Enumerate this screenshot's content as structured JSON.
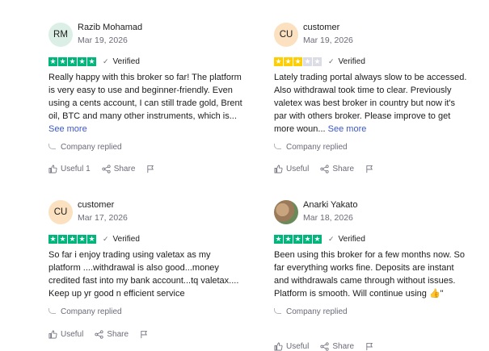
{
  "reviews": [
    {
      "initials": "RM",
      "name": "Razib Mohamad",
      "date": "Mar 19, 2026",
      "rating": 5,
      "verified": "Verified",
      "text": "Really happy with this broker so far! The platform is very easy to use and beginner-friendly. Even using a cents account, I can still trade gold, Brent oil, BTC and many other instruments, which is...",
      "see_more": "See more",
      "replied": "Company replied",
      "useful": "Useful",
      "useful_count": "1",
      "share": "Share",
      "avatar_color": "#dcefe6"
    },
    {
      "initials": "CU",
      "name": "customer",
      "date": "Mar 19, 2026",
      "rating": 3,
      "verified": "Verified",
      "text": "Lately trading portal always slow to be accessed. Also withdrawal took time to clear. Previously valetex was best broker in country but now it's par with others broker. Please improve to get more woun...",
      "see_more": "See more",
      "replied": "Company replied",
      "useful": "Useful",
      "useful_count": "",
      "share": "Share",
      "avatar_color": "#fbe1c0"
    },
    {
      "initials": "CU",
      "name": "customer",
      "date": "Mar 17, 2026",
      "rating": 5,
      "verified": "Verified",
      "text": "So far i enjoy trading using valetax as my platform ....withdrawal is also good...money credited fast into my bank account...tq valetax.... Keep up yr good n efficient service",
      "see_more": "",
      "replied": "Company replied",
      "useful": "Useful",
      "useful_count": "",
      "share": "Share",
      "avatar_color": "#fbe1c0"
    },
    {
      "initials": "",
      "name": "Anarki Yakato",
      "date": "Mar 18, 2026",
      "rating": 5,
      "verified": "Verified",
      "text": "Been using this broker for a few months now. So far everything works fine. Deposits are instant and withdrawals came through without issues. Platform is smooth. Will continue using 👍\"",
      "see_more": "",
      "replied": "Company replied",
      "useful": "Useful",
      "useful_count": "",
      "share": "Share",
      "avatar_color": "photo"
    }
  ],
  "colors": {
    "star_green": "#00b67a",
    "star_yellow": "#ffce00",
    "star_empty": "#dcdce6",
    "link": "#3b57c9"
  },
  "icons": {
    "thumb": "thumbs-up-icon",
    "share": "share-icon",
    "flag": "flag-icon",
    "check": "check-icon",
    "reply": "reply-icon"
  }
}
